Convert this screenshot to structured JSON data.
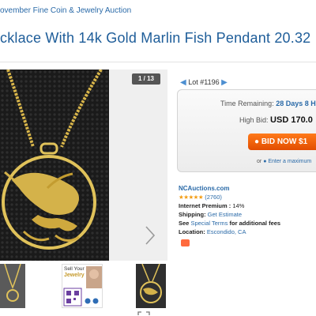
{
  "breadcrumb": "ovember Fine Coin & Jewelry Auction",
  "title": "cklace With 14k Gold Marlin Fish Pendant 20.32",
  "gallery": {
    "counter": "1 / 13",
    "thumb_ad_line1": "Sell Your",
    "thumb_ad_line2": "Jewelry"
  },
  "lot": {
    "label": "Lot #1196"
  },
  "bidding": {
    "time_label": "Time Remaining:",
    "time_value": "28 Days 8 H",
    "bid_label": "High Bid:",
    "bid_value": "USD 170.0",
    "bid_button": "BID NOW $1",
    "max_prefix": "or",
    "max_link": "Enter a maximum"
  },
  "seller": {
    "name": "NCAuctions.com",
    "stars": "★★★★★",
    "reviews": "(2760)",
    "premium_label": "Internet Premium :",
    "premium_value": "14%",
    "shipping_label": "Shipping:",
    "shipping_link": "Get Estimate",
    "terms_prefix": "See",
    "terms_link": "Special Terms",
    "terms_suffix": "for additional fees",
    "location_label": "Location:",
    "location_value": "Escondido, CA"
  },
  "colors": {
    "link": "#2a6aa8",
    "bid_button": "#ff6a00",
    "stars": "#f39c12"
  }
}
